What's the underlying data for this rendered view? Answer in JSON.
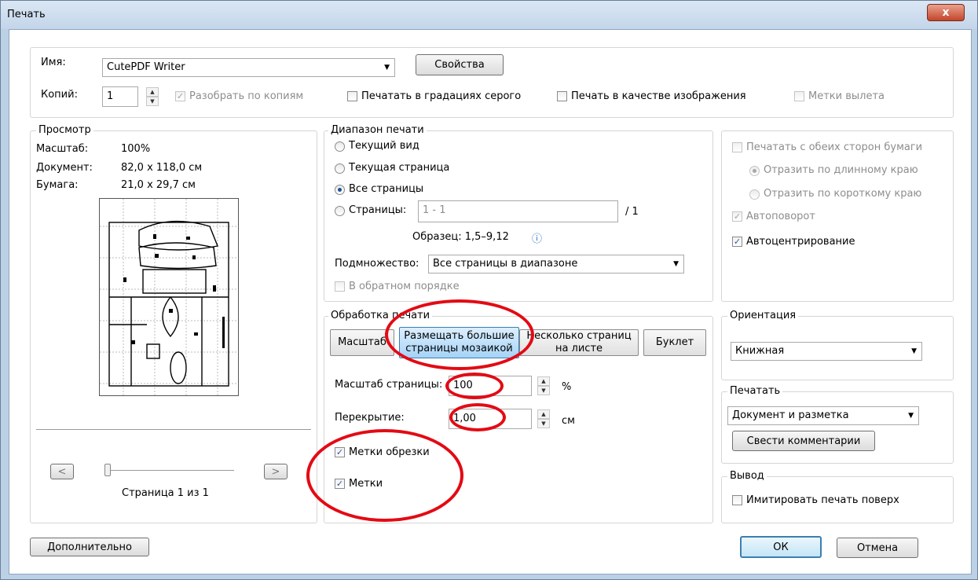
{
  "window": {
    "title": "Печать",
    "close_label": "x"
  },
  "printer": {
    "name_label": "Имя:",
    "name_value": "CutePDF Writer",
    "properties_button": "Свойства",
    "copies_label": "Копий:",
    "copies_value": "1",
    "collate_label": "Разобрать по копиям",
    "collate_checked": true,
    "grayscale_label": "Печатать в градациях серого",
    "as_image_label": "Печать в качестве изображения",
    "bleed_marks_label": "Метки вылета"
  },
  "preview": {
    "group_label": "Просмотр",
    "scale_label": "Масштаб:",
    "scale_value": "100%",
    "document_label": "Документ:",
    "document_value": "82,0 x 118,0 см",
    "paper_label": "Бумага:",
    "paper_value": "21,0 x 29,7 см",
    "prev_button": "<",
    "next_button": ">",
    "page_status": "Страница 1 из 1"
  },
  "print_range": {
    "group_label": "Диапазон печати",
    "options": [
      "Текущий вид",
      "Текущая страница",
      "Все страницы",
      "Страницы:"
    ],
    "selected": "Все страницы",
    "pages_placeholder": "1 - 1",
    "pages_total": "/ 1",
    "sample": "Образец: 1,5–9,12",
    "subset_label": "Подмножество:",
    "subset_value": "Все страницы в диапазоне",
    "reverse_label": "В обратном порядке"
  },
  "page_handling": {
    "group_label": "Обработка печати",
    "tabs": [
      "Масштаб",
      "Размещать большие страницы мозаикой",
      "Несколько страниц на листе",
      "Буклет"
    ],
    "tab_lines": {
      "tile_1": "Размещать большие",
      "tile_2": "страницы мозаикой",
      "multi_1": "Несколько страниц",
      "multi_2": "на листе"
    },
    "selected_tab": "Размещать большие страницы мозаикой",
    "page_scale_label": "Масштаб страницы:",
    "page_scale_value": "100",
    "page_scale_unit": "%",
    "overlap_label": "Перекрытие:",
    "overlap_value": "1,00",
    "overlap_unit": "см",
    "cut_marks_label": "Метки обрезки",
    "cut_marks_checked": true,
    "labels_label": "Метки",
    "labels_checked": true
  },
  "duplex": {
    "both_sides_label": "Печатать с обеих сторон бумаги",
    "long_edge_label": "Отразить по длинному краю",
    "short_edge_label": "Отразить по короткому краю",
    "auto_rotate_label": "Автоповорот",
    "auto_center_label": "Автоцентрирование"
  },
  "orientation": {
    "group_label": "Ориентация",
    "value": "Книжная"
  },
  "print_what": {
    "group_label": "Печатать",
    "value": "Документ и разметка",
    "summarize_button": "Свести комментарии"
  },
  "output": {
    "group_label": "Вывод",
    "simulate_overprint_label": "Имитировать печать поверх"
  },
  "footer": {
    "advanced_button": "Дополнительно",
    "ok_button": "ОК",
    "cancel_button": "Отмена"
  },
  "colors": {
    "annotation_red": "#e30a14",
    "selected_tab": "#a6d3f6"
  }
}
